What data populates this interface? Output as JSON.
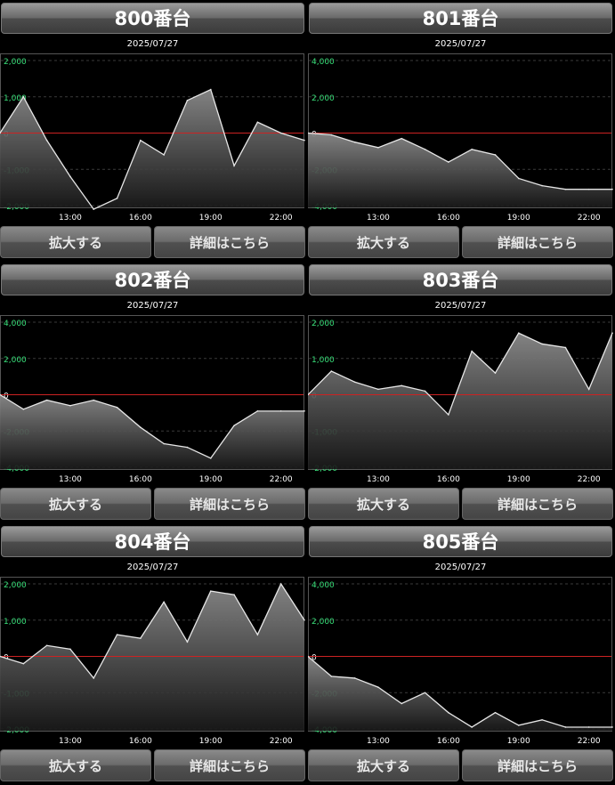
{
  "labels": {
    "zoom": "拡大する",
    "detail": "詳細はこちら"
  },
  "colors": {
    "zero_line": "#cc2222",
    "y_tick": "#39e07a",
    "series": "#e6e6e6"
  },
  "chart_data": [
    {
      "type": "area",
      "title": "800番台",
      "date": "2025/07/27",
      "x": [
        10,
        11,
        12,
        13,
        14,
        15,
        16,
        17,
        18,
        19,
        20,
        21,
        22,
        23
      ],
      "values": [
        0,
        1000,
        -200,
        -1200,
        -2100,
        -1800,
        -200,
        -600,
        900,
        1200,
        -900,
        300,
        0,
        -200
      ],
      "y_ticks": [
        2000,
        1000,
        0,
        -1000,
        -2000
      ],
      "y_tick_labels": [
        "2,000",
        "1,000",
        "0",
        "-1,000",
        "-2,000"
      ],
      "ylim": [
        -2000,
        2000
      ],
      "x_ticks": [
        13,
        16,
        19,
        22
      ],
      "x_tick_labels": [
        "13:00",
        "16:00",
        "19:00",
        "22:00"
      ]
    },
    {
      "type": "area",
      "title": "801番台",
      "date": "2025/07/27",
      "x": [
        10,
        11,
        12,
        13,
        14,
        15,
        16,
        17,
        18,
        19,
        20,
        21,
        22,
        23
      ],
      "values": [
        0,
        -100,
        -500,
        -800,
        -300,
        -900,
        -1600,
        -900,
        -1200,
        -2500,
        -2900,
        -3100,
        -3100,
        -3100
      ],
      "y_ticks": [
        4000,
        2000,
        0,
        -2000,
        -4000
      ],
      "y_tick_labels": [
        "4,000",
        "2,000",
        "0",
        "-2,000",
        "-4,000"
      ],
      "ylim": [
        -4000,
        4000
      ],
      "x_ticks": [
        13,
        16,
        19,
        22
      ],
      "x_tick_labels": [
        "13:00",
        "16:00",
        "19:00",
        "22:00"
      ]
    },
    {
      "type": "area",
      "title": "802番台",
      "date": "2025/07/27",
      "x": [
        10,
        11,
        12,
        13,
        14,
        15,
        16,
        17,
        18,
        19,
        20,
        21,
        22,
        23
      ],
      "values": [
        0,
        -800,
        -300,
        -600,
        -300,
        -700,
        -1800,
        -2700,
        -2900,
        -3500,
        -1700,
        -900,
        -900,
        -900
      ],
      "y_ticks": [
        4000,
        2000,
        0,
        -2000,
        -4000
      ],
      "y_tick_labels": [
        "4,000",
        "2,000",
        "0",
        "-2,000",
        "-4,000"
      ],
      "ylim": [
        -4000,
        4000
      ],
      "x_ticks": [
        13,
        16,
        19,
        22
      ],
      "x_tick_labels": [
        "13:00",
        "16:00",
        "19:00",
        "22:00"
      ]
    },
    {
      "type": "area",
      "title": "803番台",
      "date": "2025/07/27",
      "x": [
        10,
        11,
        12,
        13,
        14,
        15,
        16,
        17,
        18,
        19,
        20,
        21,
        22,
        23
      ],
      "values": [
        0,
        1300,
        700,
        300,
        500,
        200,
        -1100,
        2400,
        1200,
        3400,
        2800,
        2600,
        300,
        3400
      ],
      "y_ticks": [
        4000,
        2000,
        0,
        -2000,
        -4000
      ],
      "y_tick_labels": [
        "2,000",
        "1,000",
        "0",
        "-1,000",
        "-2,000"
      ],
      "ylim": [
        -4000,
        4000
      ],
      "x_ticks": [
        13,
        16,
        19,
        22
      ],
      "x_tick_labels": [
        "13:00",
        "16:00",
        "19:00",
        "22:00"
      ]
    },
    {
      "type": "area",
      "title": "804番台",
      "date": "2025/07/27",
      "x": [
        10,
        11,
        12,
        13,
        14,
        15,
        16,
        17,
        18,
        19,
        20,
        21,
        22,
        23
      ],
      "values": [
        0,
        -200,
        300,
        200,
        -600,
        600,
        500,
        1500,
        400,
        1800,
        1700,
        600,
        2000,
        1000
      ],
      "y_ticks": [
        2000,
        1000,
        0,
        -1000,
        -2000
      ],
      "y_tick_labels": [
        "2,000",
        "1,000",
        "0",
        "-1,000",
        "-2,000"
      ],
      "ylim": [
        -2000,
        2000
      ],
      "x_ticks": [
        13,
        16,
        19,
        22
      ],
      "x_tick_labels": [
        "13:00",
        "16:00",
        "19:00",
        "22:00"
      ]
    },
    {
      "type": "area",
      "title": "805番台",
      "date": "2025/07/27",
      "x": [
        10,
        11,
        12,
        13,
        14,
        15,
        16,
        17,
        18,
        19,
        20,
        21,
        22,
        23
      ],
      "values": [
        0,
        -1100,
        -1200,
        -1700,
        -2600,
        -2000,
        -3100,
        -3900,
        -3100,
        -3800,
        -3500,
        -3900,
        -3900,
        -3900
      ],
      "y_ticks": [
        4000,
        2000,
        0,
        -2000,
        -4000
      ],
      "y_tick_labels": [
        "4,000",
        "2,000",
        "0",
        "-2,000",
        "-4,000"
      ],
      "ylim": [
        -4000,
        4000
      ],
      "x_ticks": [
        13,
        16,
        19,
        22
      ],
      "x_tick_labels": [
        "13:00",
        "16:00",
        "19:00",
        "22:00"
      ]
    }
  ]
}
